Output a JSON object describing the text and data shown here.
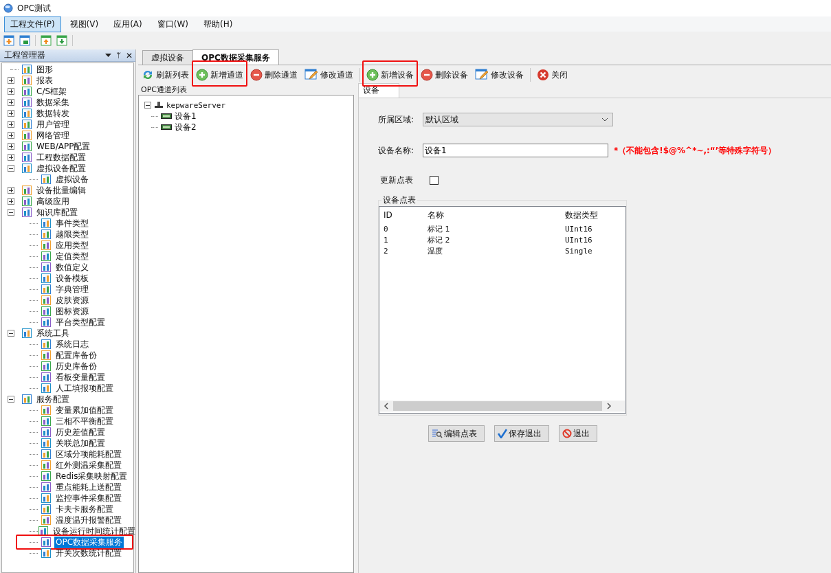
{
  "window": {
    "title": "OPC测试"
  },
  "menu": [
    {
      "label": "工程文件(P)",
      "selected": true
    },
    {
      "label": "视图(V)",
      "selected": false
    },
    {
      "label": "应用(A)",
      "selected": false
    },
    {
      "label": "窗口(W)",
      "selected": false
    },
    {
      "label": "帮助(H)",
      "selected": false
    }
  ],
  "quick_toolbar": [
    {
      "kind": "new"
    },
    {
      "kind": "open"
    },
    {
      "kind": "up"
    },
    {
      "kind": "down"
    }
  ],
  "project_panel": {
    "title": "工程管理器",
    "pin": "ᛘ",
    "close": "✕",
    "tree": [
      {
        "label": "图形",
        "selected": false
      },
      {
        "label": "报表",
        "expanded": false,
        "selected": false
      },
      {
        "label": "C/S框架",
        "expanded": false,
        "selected": false
      },
      {
        "label": "数据采集",
        "expanded": false,
        "selected": false
      },
      {
        "label": "数据转发",
        "expanded": false,
        "selected": false
      },
      {
        "label": "用户管理",
        "expanded": false,
        "selected": false
      },
      {
        "label": "网络管理",
        "expanded": false,
        "selected": false
      },
      {
        "label": "WEB/APP配置",
        "expanded": false,
        "selected": false
      },
      {
        "label": "工程数据配置",
        "expanded": false,
        "selected": false
      },
      {
        "label": "虚拟设备配置",
        "expanded": true,
        "selected": false,
        "children": [
          {
            "label": "虚拟设备",
            "selected": false
          }
        ]
      },
      {
        "label": "设备批量编辑",
        "expanded": false,
        "selected": false
      },
      {
        "label": "高级应用",
        "expanded": false,
        "selected": false
      },
      {
        "label": "知识库配置",
        "expanded": true,
        "selected": false,
        "children": [
          {
            "label": "事件类型",
            "selected": false
          },
          {
            "label": "越限类型",
            "selected": false
          },
          {
            "label": "应用类型",
            "selected": false
          },
          {
            "label": "定值类型",
            "selected": false
          },
          {
            "label": "数值定义",
            "selected": false
          },
          {
            "label": "设备模板",
            "selected": false
          },
          {
            "label": "字典管理",
            "selected": false
          },
          {
            "label": "皮肤资源",
            "selected": false
          },
          {
            "label": "图标资源",
            "selected": false
          },
          {
            "label": "平台类型配置",
            "selected": false
          }
        ]
      },
      {
        "label": "系统工具",
        "expanded": true,
        "selected": false,
        "children": [
          {
            "label": "系统日志",
            "selected": false
          },
          {
            "label": "配置库备份",
            "selected": false
          },
          {
            "label": "历史库备份",
            "selected": false
          },
          {
            "label": "看板变量配置",
            "selected": false
          },
          {
            "label": "人工填报项配置",
            "selected": false
          }
        ]
      },
      {
        "label": "服务配置",
        "expanded": true,
        "selected": false,
        "children": [
          {
            "label": "变量累加值配置",
            "selected": false
          },
          {
            "label": "三相不平衡配置",
            "selected": false
          },
          {
            "label": "历史差值配置",
            "selected": false
          },
          {
            "label": "关联总加配置",
            "selected": false
          },
          {
            "label": "区域分项能耗配置",
            "selected": false
          },
          {
            "label": "红外测温采集配置",
            "selected": false
          },
          {
            "label": "Redis采集映射配置",
            "selected": false
          },
          {
            "label": "重点能耗上送配置",
            "selected": false
          },
          {
            "label": "监控事件采集配置",
            "selected": false
          },
          {
            "label": "卡夫卡服务配置",
            "selected": false
          },
          {
            "label": "温度温升报警配置",
            "selected": false
          },
          {
            "label": "设备运行时间统计配置",
            "selected": false
          },
          {
            "label": "OPC数据采集服务",
            "selected": true,
            "highlighted": true
          },
          {
            "label": "开关次数统计配置",
            "selected": false
          }
        ]
      }
    ]
  },
  "tabs": [
    {
      "label": "虚拟设备",
      "selected": false
    },
    {
      "label": "OPC数据采集服务",
      "selected": true
    }
  ],
  "toolbar": [
    {
      "kind": "refresh",
      "label": "刷新列表",
      "highlighted": false
    },
    {
      "kind": "add",
      "label": "新增通道",
      "highlighted": true
    },
    {
      "kind": "remove",
      "label": "删除通道",
      "highlighted": false
    },
    {
      "kind": "edit",
      "label": "修改通道",
      "highlighted": false
    },
    {
      "kind": "separator"
    },
    {
      "kind": "add",
      "label": "新增设备",
      "highlighted": true
    },
    {
      "kind": "remove",
      "label": "删除设备",
      "highlighted": false
    },
    {
      "kind": "edit",
      "label": "修改设备",
      "highlighted": false
    },
    {
      "kind": "separator"
    },
    {
      "kind": "close",
      "label": "关闭",
      "highlighted": false
    }
  ],
  "channel_list": {
    "title": "OPC通道列表",
    "server": {
      "label": "kepwareServer",
      "expanded": true,
      "children": [
        {
          "label": "设备1"
        },
        {
          "label": "设备2"
        }
      ]
    }
  },
  "device_form": {
    "tab": "设备",
    "area_label": "所属区域:",
    "area_value": "默认区域",
    "name_label": "设备名称:",
    "name_value": "设备1",
    "name_hint": "*（不能包含!$@%^*~,:“’等特殊字符号）",
    "update_label": "更新点表",
    "update_checked": false,
    "points": {
      "title": "设备点表",
      "columns": [
        "ID",
        "名称",
        "数据类型"
      ],
      "rows": [
        [
          "0",
          "标记 1",
          "UInt16"
        ],
        [
          "1",
          "标记 2",
          "UInt16"
        ],
        [
          "2",
          "温度",
          "Single"
        ]
      ]
    },
    "buttons": [
      {
        "kind": "edit",
        "label": "编辑点表"
      },
      {
        "kind": "save",
        "label": "保存退出"
      },
      {
        "kind": "exit",
        "label": "退出"
      }
    ]
  }
}
